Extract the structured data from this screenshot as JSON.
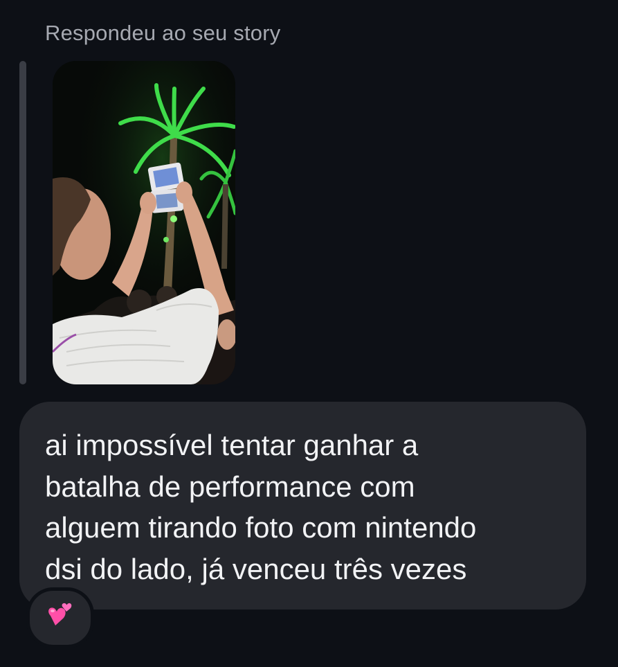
{
  "story_reply": {
    "label": "Respondeu ao seu story",
    "thumbnail_icon": "story-photo"
  },
  "message": {
    "text": "ai impossível tentar ganhar a\nbatalha de performance com\nalguem tirando foto com nintendo\ndsi do lado, já venceu três vezes"
  },
  "reaction": {
    "icon": "two-hearts-icon"
  },
  "colors": {
    "background": "#0d1016",
    "bubble": "#25272d",
    "label": "#a6a9b1",
    "text": "#f2f3f5",
    "heart": "#ff4fa8"
  }
}
